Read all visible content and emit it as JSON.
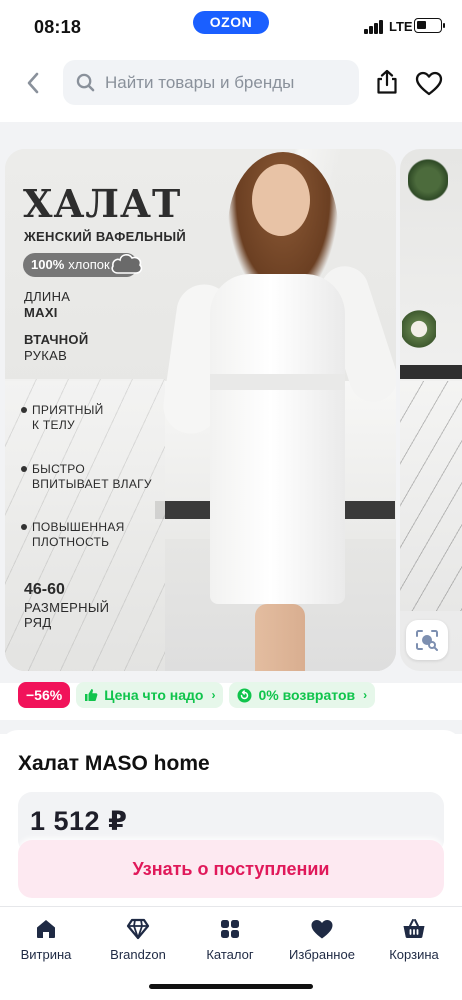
{
  "status_bar": {
    "time": "08:18",
    "network": "LTE",
    "carrier_pill": "OZON"
  },
  "header": {
    "search_placeholder": "Найти товары и бренды"
  },
  "image": {
    "title": "ХАЛАТ",
    "subtitle": "ЖЕНСКИЙ ВАФЕЛЬНЫЙ",
    "cotton_pct": "100%",
    "cotton_label": "хлопок",
    "length_label": "ДЛИНА",
    "length_value": "MAXI",
    "sleeve_bold": "ВТАЧНОЙ",
    "sleeve_text": "РУКАВ",
    "bullet1_l1": "ПРИЯТНЫЙ",
    "bullet1_l2": "К ТЕЛУ",
    "bullet2_l1": "БЫСТРО",
    "bullet2_l2": "ВПИТЫВАЕТ ВЛАГУ",
    "bullet3_l1": "ПОВЫШЕННАЯ",
    "bullet3_l2": "ПЛОТНОСТЬ",
    "size_range": "46-60",
    "size_l1": "РАЗМЕРНЫЙ",
    "size_l2": "РЯД"
  },
  "badges": {
    "discount": "−56%",
    "price_ok": "Цена что надо",
    "returns": "0% возвратов"
  },
  "product": {
    "title": "Халат MASO home",
    "price": "1 512 ₽",
    "notify_label": "Узнать о поступлении"
  },
  "nav": [
    {
      "label": "Витрина",
      "icon": "home-icon"
    },
    {
      "label": "Brandzon",
      "icon": "diamond-icon"
    },
    {
      "label": "Каталог",
      "icon": "grid-icon"
    },
    {
      "label": "Избранное",
      "icon": "heart-icon"
    },
    {
      "label": "Корзина",
      "icon": "basket-icon"
    }
  ],
  "colors": {
    "ozon_blue": "#1a5fff",
    "discount_pink": "#f1135a",
    "badge_green": "#10c44c",
    "notify_pink": "#e0195a",
    "nav_dark": "#1f2a44"
  }
}
